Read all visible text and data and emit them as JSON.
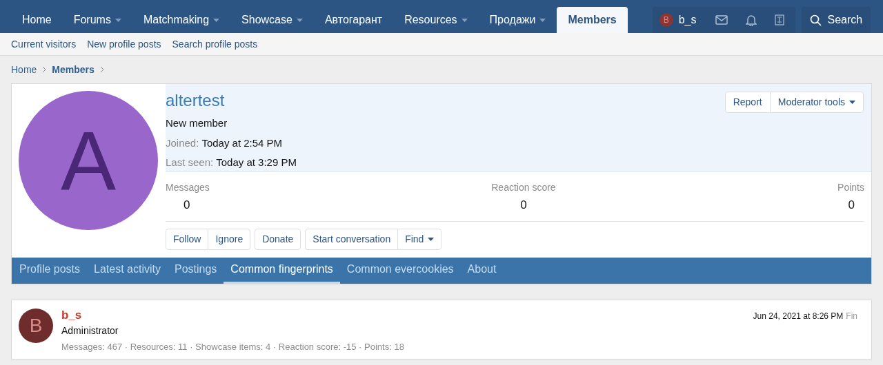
{
  "nav": {
    "items": [
      {
        "label": "Home",
        "dropdown": false,
        "selected": false
      },
      {
        "label": "Forums",
        "dropdown": true,
        "selected": false
      },
      {
        "label": "Matchmaking",
        "dropdown": true,
        "selected": false
      },
      {
        "label": "Showcase",
        "dropdown": true,
        "selected": false
      },
      {
        "label": "Автогарант",
        "dropdown": false,
        "selected": false
      },
      {
        "label": "Resources",
        "dropdown": true,
        "selected": false
      },
      {
        "label": "Продажи",
        "dropdown": true,
        "selected": false
      },
      {
        "label": "Members",
        "dropdown": false,
        "selected": true
      }
    ],
    "user": {
      "initial": "B",
      "name": "b_s"
    },
    "search": "Search"
  },
  "subnav": [
    "Current visitors",
    "New profile posts",
    "Search profile posts"
  ],
  "breadcrumb": [
    {
      "label": "Home",
      "current": false
    },
    {
      "label": "Members",
      "current": true
    }
  ],
  "profile": {
    "initial": "A",
    "name": "altertest",
    "title": "New member",
    "details": [
      {
        "label": "Joined:",
        "value": "Today at 2:54 PM"
      },
      {
        "label": "Last seen:",
        "value": "Today at 3:29 PM"
      }
    ],
    "header_buttons": [
      {
        "label": "Report",
        "dropdown": false
      },
      {
        "label": "Moderator tools",
        "dropdown": true
      }
    ],
    "stats": [
      {
        "label": "Messages",
        "value": "0"
      },
      {
        "label": "Reaction score",
        "value": "0"
      },
      {
        "label": "Points",
        "value": "0"
      }
    ],
    "button_groups": [
      [
        {
          "label": "Follow",
          "dropdown": false
        },
        {
          "label": "Ignore",
          "dropdown": false
        }
      ],
      [
        {
          "label": "Donate",
          "dropdown": false
        }
      ],
      [
        {
          "label": "Start conversation",
          "dropdown": false
        },
        {
          "label": "Find",
          "dropdown": true
        }
      ]
    ]
  },
  "tabs": [
    {
      "label": "Profile posts",
      "selected": false
    },
    {
      "label": "Latest activity",
      "selected": false
    },
    {
      "label": "Postings",
      "selected": false
    },
    {
      "label": "Common fingerprints",
      "selected": true
    },
    {
      "label": "Common evercookies",
      "selected": false
    },
    {
      "label": "About",
      "selected": false
    }
  ],
  "results": [
    {
      "initial": "B",
      "name": "b_s",
      "role": "Administrator",
      "stats": "Messages: 467 · Resources: 11 · Showcase items: 4 · Reaction score: -15 · Points: 18",
      "date": "Jun 24, 2021 at 8:26 PM",
      "extra": "Fin"
    }
  ]
}
